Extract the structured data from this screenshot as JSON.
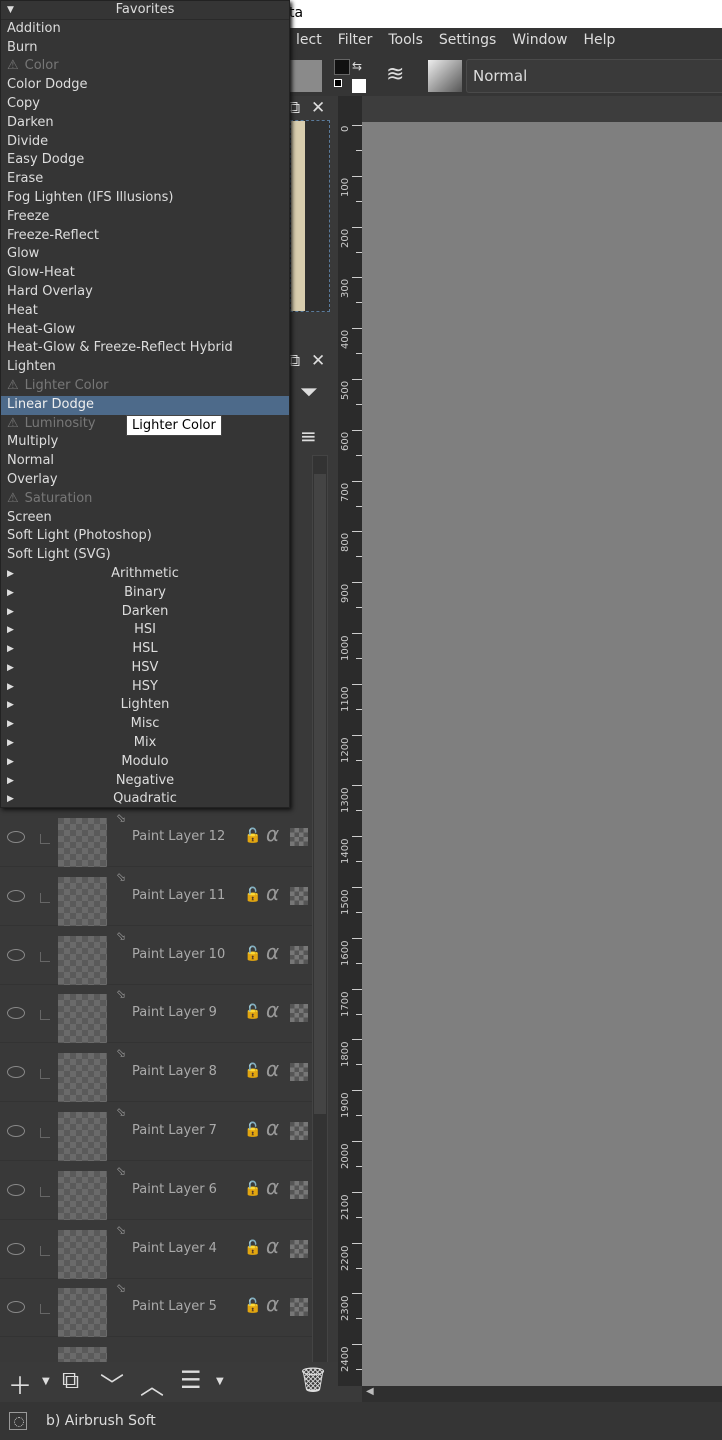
{
  "window": {
    "title_fragment": "ta"
  },
  "menubar": [
    "lect",
    "Filter",
    "Tools",
    "Settings",
    "Window",
    "Help"
  ],
  "toolbar": {
    "blend_mode": "Normal",
    "swap_icon": "⇆",
    "flow_icon": "≋"
  },
  "popup": {
    "header": "Favorites",
    "items": [
      {
        "label": "Addition"
      },
      {
        "label": "Burn"
      },
      {
        "label": "Color",
        "disabled": true
      },
      {
        "label": "Color Dodge"
      },
      {
        "label": "Copy"
      },
      {
        "label": "Darken"
      },
      {
        "label": "Divide"
      },
      {
        "label": "Easy Dodge"
      },
      {
        "label": "Erase"
      },
      {
        "label": "Fog Lighten (IFS Illusions)"
      },
      {
        "label": "Freeze"
      },
      {
        "label": "Freeze-Reflect"
      },
      {
        "label": "Glow"
      },
      {
        "label": "Glow-Heat"
      },
      {
        "label": "Hard Overlay"
      },
      {
        "label": "Heat"
      },
      {
        "label": "Heat-Glow"
      },
      {
        "label": "Heat-Glow & Freeze-Reflect Hybrid"
      },
      {
        "label": "Lighten"
      },
      {
        "label": "Lighter Color",
        "disabled": true
      },
      {
        "label": "Linear Dodge",
        "selected": true
      },
      {
        "label": "Luminosity",
        "disabled": true
      },
      {
        "label": "Multiply"
      },
      {
        "label": "Normal"
      },
      {
        "label": "Overlay"
      },
      {
        "label": "Saturation",
        "disabled": true
      },
      {
        "label": "Screen"
      },
      {
        "label": "Soft Light (Photoshop)"
      },
      {
        "label": "Soft Light (SVG)"
      }
    ],
    "groups": [
      "Arithmetic",
      "Binary",
      "Darken",
      "HSI",
      "HSL",
      "HSV",
      "HSY",
      "Lighten",
      "Misc",
      "Mix",
      "Modulo",
      "Negative",
      "Quadratic"
    ]
  },
  "tooltip": "Lighter Color",
  "layers": [
    "Paint Layer 12",
    "Paint Layer 11",
    "Paint Layer 10",
    "Paint Layer 9",
    "Paint Layer 8",
    "Paint Layer 7",
    "Paint Layer 6",
    "Paint Layer 4",
    "Paint Layer 5"
  ],
  "ruler": [
    "0",
    "100",
    "200",
    "300",
    "400",
    "500",
    "600",
    "700",
    "800",
    "900",
    "1000",
    "1100",
    "1200",
    "1300",
    "1400",
    "1500",
    "1600",
    "1700",
    "1800",
    "1900",
    "2000",
    "2100",
    "2200",
    "2300",
    "2400"
  ],
  "status": {
    "brush": "b) Airbrush Soft"
  }
}
